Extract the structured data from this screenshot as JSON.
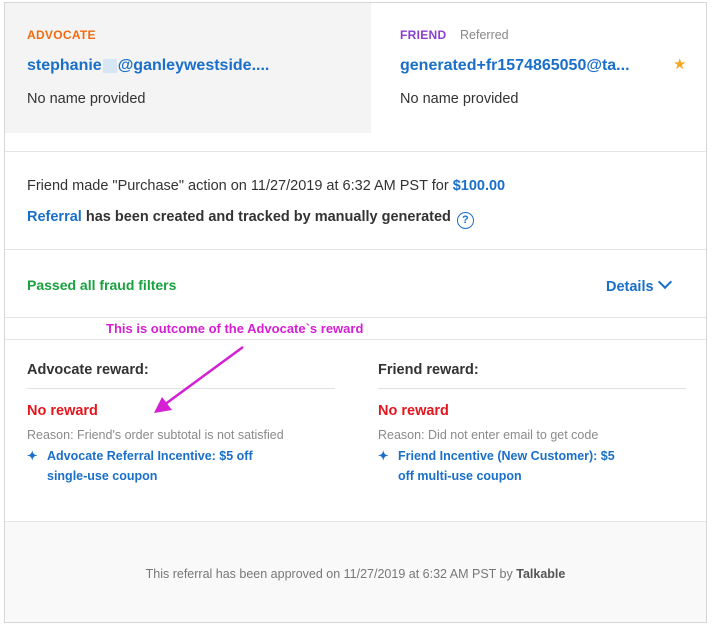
{
  "advocate": {
    "role_label": "ADVOCATE",
    "email_prefix": "stephanie",
    "email_suffix": "@ganleywestside....",
    "name": "No name provided"
  },
  "friend": {
    "role_label": "FRIEND",
    "referred_label": "Referred",
    "email": "generated+fr1574865050@ta...",
    "name": "No name provided",
    "star_icon": "star-icon"
  },
  "action": {
    "text": "Friend made \"Purchase\" action on 11/27/2019 at 6:32 AM PST for",
    "amount": "$100.00"
  },
  "created": {
    "link": "Referral",
    "text": "has been created and tracked by manually generated",
    "help_icon": "?"
  },
  "fraud": {
    "status": "Passed all fraud filters",
    "details_label": "Details"
  },
  "annotation": "This is outcome of the Advocate`s reward",
  "rewards": {
    "advocate": {
      "heading": "Advocate reward:",
      "status": "No reward",
      "reason": "Reason: Friend's order subtotal is not satisfied",
      "incentive_line1": "Advocate Referral Incentive: $5 off",
      "incentive_line2": "single-use coupon"
    },
    "friend": {
      "heading": "Friend reward:",
      "status": "No reward",
      "reason": "Reason: Did not enter email to get code",
      "incentive_line1": "Friend Incentive (New Customer): $5",
      "incentive_line2": "off multi-use coupon"
    }
  },
  "footer": {
    "approved_text": "This referral has been approved on 11/27/2019 at 6:32 AM PST by",
    "approved_by": "Talkable"
  },
  "colors": {
    "advocate": "#f26a0f",
    "friend": "#8a3fd1",
    "link": "#1a6fc9",
    "pass": "#19a13f",
    "no_reward": "#e4161d",
    "annotation": "#d41fd4"
  }
}
